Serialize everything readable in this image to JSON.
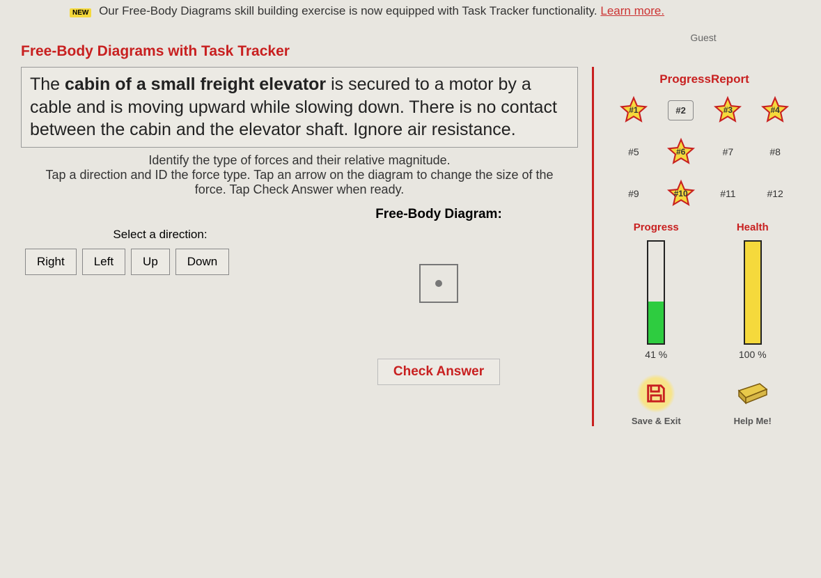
{
  "banner": {
    "new_badge": "NEW",
    "text": "Our Free-Body Diagrams skill building exercise is now equipped with Task Tracker functionality.",
    "link_text": "Learn more."
  },
  "page_title": "Free-Body Diagrams with Task Tracker",
  "problem": {
    "pre": "The ",
    "bold": "cabin of a small freight elevator",
    "post": " is secured to a motor by a cable and is moving upward while slowing down. There is no contact between the cabin and the elevator shaft. Ignore air resistance."
  },
  "instructions": {
    "line1": "Identify the type of forces and their relative magnitude.",
    "line2": "Tap a direction and ID the force type. Tap an arrow on the diagram to change the size of the force. Tap Check Answer when ready."
  },
  "fbd_title": "Free-Body Diagram:",
  "select_direction_label": "Select a direction:",
  "directions": {
    "right": "Right",
    "left": "Left",
    "up": "Up",
    "down": "Down"
  },
  "check_answer_label": "Check Answer",
  "sidebar": {
    "guest_label": "Guest",
    "progress_report_title": "ProgressReport",
    "items": [
      {
        "label": "#1",
        "starred": true
      },
      {
        "label": "#2",
        "starred": false,
        "current": true
      },
      {
        "label": "#3",
        "starred": true
      },
      {
        "label": "#4",
        "starred": true
      },
      {
        "label": "#5",
        "starred": false
      },
      {
        "label": "#6",
        "starred": true
      },
      {
        "label": "#7",
        "starred": false
      },
      {
        "label": "#8",
        "starred": false
      },
      {
        "label": "#9",
        "starred": false
      },
      {
        "label": "#10",
        "starred": true
      },
      {
        "label": "#11",
        "starred": false
      },
      {
        "label": "#12",
        "starred": false
      }
    ],
    "progress": {
      "title": "Progress",
      "value_label": "41 %",
      "percent": 41
    },
    "health": {
      "title": "Health",
      "value_label": "100 %",
      "percent": 100
    },
    "save_exit_label": "Save & Exit",
    "help_me_label": "Help Me!"
  }
}
